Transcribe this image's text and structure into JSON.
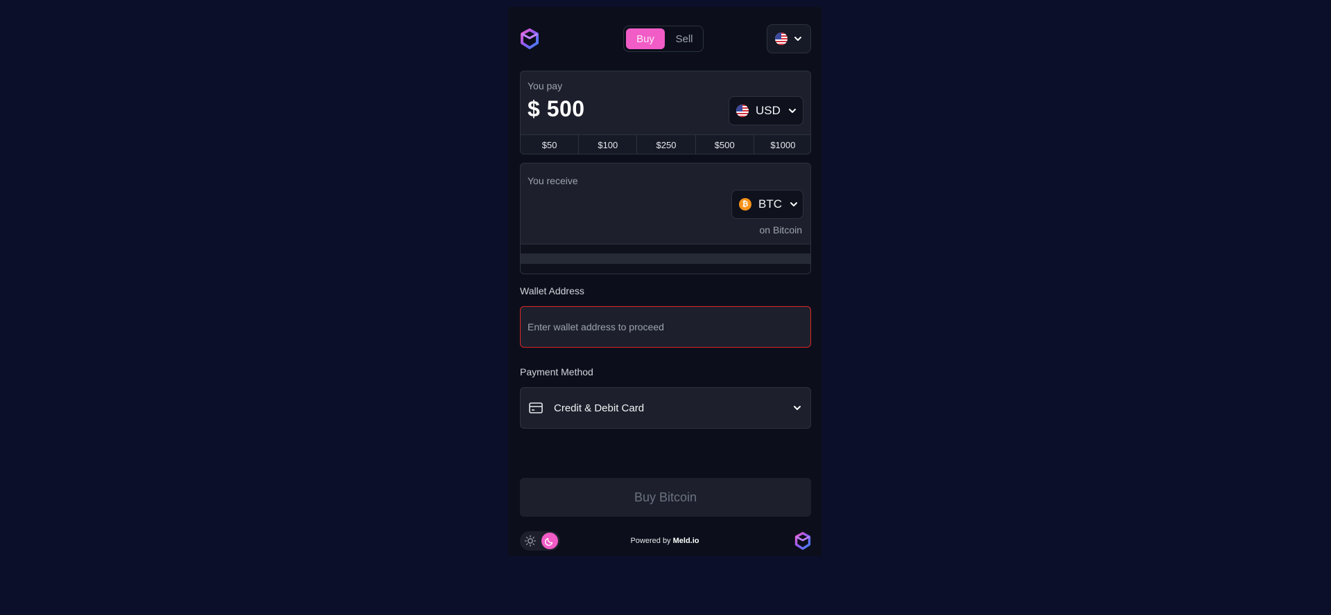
{
  "header": {
    "mode_buy": "Buy",
    "mode_sell": "Sell",
    "active_mode": "Buy",
    "country_icon": "us-flag-icon"
  },
  "pay": {
    "label": "You pay",
    "symbol": "$",
    "amount": "500",
    "currency": "USD",
    "presets": [
      "$50",
      "$100",
      "$250",
      "$500",
      "$1000"
    ]
  },
  "receive": {
    "label": "You receive",
    "coin": "BTC",
    "coin_icon": "bitcoin-icon",
    "network": "on Bitcoin"
  },
  "wallet": {
    "label": "Wallet Address",
    "placeholder": "Enter wallet address to proceed",
    "value": ""
  },
  "payment": {
    "label": "Payment Method",
    "selected": "Credit & Debit Card",
    "icon": "credit-card-icon"
  },
  "cta": {
    "label": "Buy Bitcoin"
  },
  "footer": {
    "powered_prefix": "Powered by",
    "powered_brand": "Meld.io",
    "theme": "dark"
  },
  "colors": {
    "background": "#0b0f29",
    "accent": "#f15cc7",
    "error_border": "#dc2626"
  }
}
